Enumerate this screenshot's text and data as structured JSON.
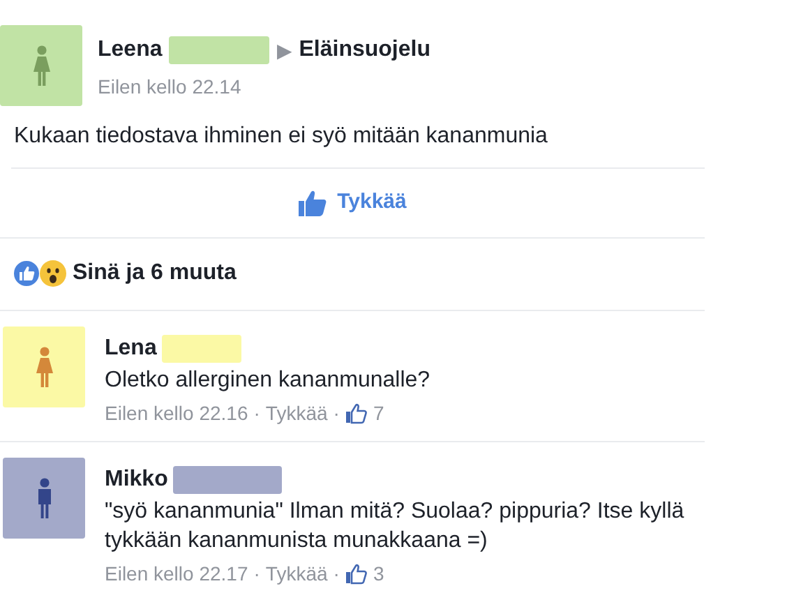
{
  "post": {
    "author": "Leena",
    "target": "Eläinsuojelu",
    "arrow": "▶",
    "time": "Eilen kello 22.14",
    "text": "Kukaan tiedostava ihminen ei syö mitään kananmunia",
    "like_label": "Tykkää"
  },
  "reactions": {
    "summary": "Sinä ja 6 muuta"
  },
  "comments": [
    {
      "author": "Lena",
      "text": "Oletko allerginen kananmunalle?",
      "time": "Eilen kello 22.16",
      "separator_1": "·",
      "like_label": "Tykkää",
      "separator_2": "·",
      "like_count": "7"
    },
    {
      "author": "Mikko",
      "text": "\"syö kananmunia\" Ilman mitä? Suolaa? pippuria? Itse kyllä tykkään kananmunista munakkaana =)",
      "time": "Eilen kello 22.17",
      "separator_1": "·",
      "like_label": "Tykkää",
      "separator_2": "·",
      "like_count": "3"
    }
  ]
}
